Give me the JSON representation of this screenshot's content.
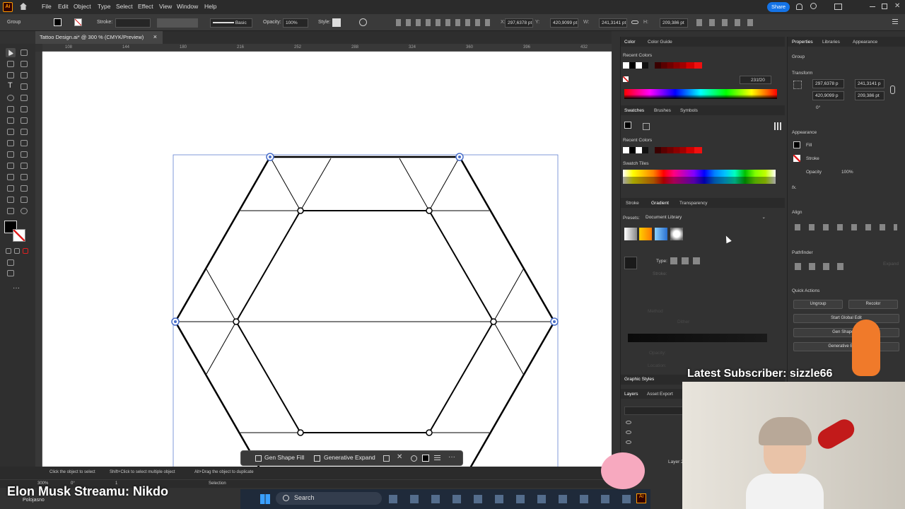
{
  "menubar": {
    "logo": "Ai",
    "items": [
      "File",
      "Edit",
      "Object",
      "Type",
      "Select",
      "Effect",
      "View",
      "Window",
      "Help"
    ],
    "share": "Share"
  },
  "control": {
    "selection": "Group",
    "stroke_label": "Stroke:",
    "brush": "Basic",
    "opacity_label": "Opacity:",
    "opacity": "100%",
    "style_label": "Style:",
    "x": "297,6378 pt",
    "y": "420,9099 pt",
    "w": "241,3141 pt",
    "h": "209,386 pt"
  },
  "document_tab": "Tattoo Design.ai* @ 300 % (CMYK/Preview)",
  "ruler_h": [
    "108",
    "144",
    "180",
    "216",
    "252",
    "288",
    "324",
    "360",
    "396",
    "432"
  ],
  "gentoolbar": {
    "gen_shape_fill": "Gen Shape Fill",
    "generative_expand": "Generative Expand"
  },
  "status": {
    "hint1": "Click the object to select",
    "hint2": "Shift+Click to select multiple object",
    "hint3": "Alt+Drag the object to duplicate",
    "zoom": "300%",
    "angle": "0°",
    "page": "1",
    "tool": "Selection"
  },
  "color_panel": {
    "tabs": [
      "Color",
      "Color Guide"
    ],
    "recent_label": "Recent Colors",
    "hex": "231f20"
  },
  "swatches_panel": {
    "tabs": [
      "Swatches",
      "Brushes",
      "Symbols"
    ],
    "recent_label": "Recent Colors",
    "tiles_label": "Swatch Tiles"
  },
  "gradient_panel": {
    "tabs": [
      "Stroke",
      "Gradient",
      "Transparency"
    ],
    "presets_label": "Presets:",
    "presets_value": "Document Library",
    "type_label": "Type:",
    "stroke_label": "Stroke:",
    "method_label": "Method",
    "dither_label": "Dither",
    "opacity_label": "Opacity:",
    "location_label": "Location:"
  },
  "graphic_styles": "Graphic Styles",
  "layers_panel": {
    "tabs": [
      "Layers",
      "Asset Export"
    ],
    "layer2": "Layer 2"
  },
  "properties": {
    "tabs": [
      "Properties",
      "Libraries",
      "Appearance"
    ],
    "group": "Group",
    "transform": "Transform",
    "x": "297,6378 p",
    "y": "420,9099 p",
    "w": "241,3141 p",
    "h": "209,386 pt",
    "angle": "0°",
    "appearance": "Appearance",
    "fill": "Fill",
    "stroke": "Stroke",
    "opacity": "Opacity",
    "opacity_value": "100%",
    "fx": "fx.",
    "align": "Align",
    "pathfinder": "Pathfinder",
    "expand": "Expand",
    "quick_actions": "Quick Actions",
    "ungroup": "Ungroup",
    "recolor": "Recolor",
    "global_edit": "Start Global Edit",
    "gen_shape_fill": "Gen Shape Fill",
    "generative_expand": "Generative Expand"
  },
  "overlay": {
    "subscriber": "Latest Subscriber: sizzle66",
    "stream_title": "Elon Musk Streamu: Nikdo",
    "stream_sub": "Polojasno"
  },
  "taskbar": {
    "search": "Search"
  },
  "colors": {
    "accent": "#1473e6",
    "panel": "#323232",
    "canvas": "#ffffff",
    "selection": "#4a6fc9"
  }
}
